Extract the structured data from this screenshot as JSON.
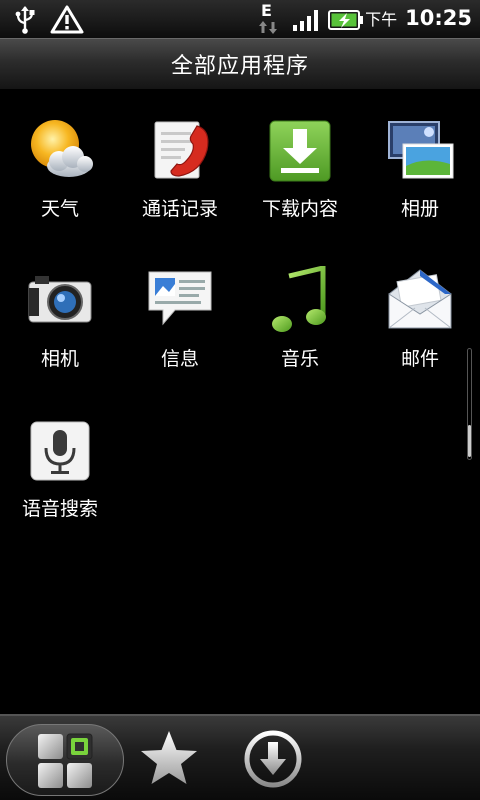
{
  "status_bar": {
    "network_type": "E",
    "ampm": "下午",
    "time": "10:25"
  },
  "header": {
    "title": "全部应用程序"
  },
  "apps": [
    {
      "label": "天气",
      "icon": "weather-icon"
    },
    {
      "label": "通话记录",
      "icon": "call-history-icon"
    },
    {
      "label": "下载内容",
      "icon": "download-icon"
    },
    {
      "label": "相册",
      "icon": "gallery-icon"
    },
    {
      "label": "相机",
      "icon": "camera-icon"
    },
    {
      "label": "信息",
      "icon": "messages-icon"
    },
    {
      "label": "音乐",
      "icon": "music-icon"
    },
    {
      "label": "邮件",
      "icon": "mail-icon"
    },
    {
      "label": "语音搜索",
      "icon": "voice-search-icon"
    }
  ],
  "dock": {
    "items": [
      "all-apps-icon",
      "star-icon",
      "download-arrow-icon"
    ]
  },
  "colors": {
    "download_green": "#6cb33f",
    "call_red": "#d62b1f",
    "music_green": "#7dc242"
  }
}
